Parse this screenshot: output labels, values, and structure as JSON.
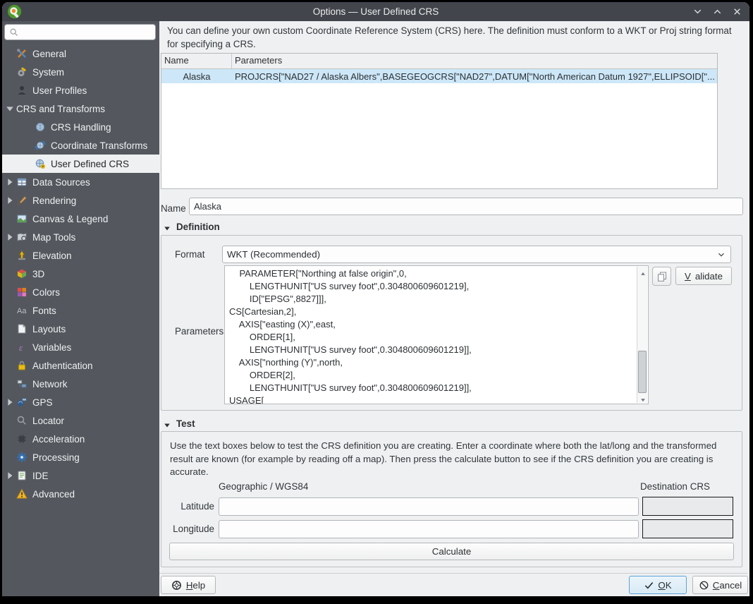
{
  "window": {
    "title": "Options — User Defined CRS",
    "controls": [
      {
        "icon": "chevron-down"
      },
      {
        "icon": "chevron-up"
      },
      {
        "icon": "close"
      }
    ]
  },
  "sidebar": {
    "search_placeholder": "",
    "search_value": "",
    "items": [
      {
        "label": "General",
        "icon": "general",
        "level": 0,
        "expander": null,
        "selected": false
      },
      {
        "label": "System",
        "icon": "system",
        "level": 0,
        "expander": null,
        "selected": false
      },
      {
        "label": "User Profiles",
        "icon": "user-profiles",
        "level": 0,
        "expander": null,
        "selected": false
      },
      {
        "label": "CRS and Transforms",
        "icon": null,
        "level": 0,
        "expander": "expanded",
        "selected": false
      },
      {
        "label": "CRS Handling",
        "icon": "crs-handling",
        "level": 1,
        "expander": null,
        "selected": false
      },
      {
        "label": "Coordinate Transforms",
        "icon": "coordinate-transforms",
        "level": 1,
        "expander": null,
        "selected": false
      },
      {
        "label": "User Defined CRS",
        "icon": "user-defined-crs",
        "level": 1,
        "expander": null,
        "selected": true
      },
      {
        "label": "Data Sources",
        "icon": "data-sources",
        "level": 0,
        "expander": "collapsed",
        "selected": false
      },
      {
        "label": "Rendering",
        "icon": "rendering",
        "level": 0,
        "expander": "collapsed",
        "selected": false
      },
      {
        "label": "Canvas & Legend",
        "icon": "canvas-legend",
        "level": 0,
        "expander": null,
        "selected": false
      },
      {
        "label": "Map Tools",
        "icon": "map-tools",
        "level": 0,
        "expander": "collapsed",
        "selected": false
      },
      {
        "label": "Elevation",
        "icon": "elevation",
        "level": 0,
        "expander": null,
        "selected": false
      },
      {
        "label": "3D",
        "icon": "three-d",
        "level": 0,
        "expander": null,
        "selected": false
      },
      {
        "label": "Colors",
        "icon": "colors",
        "level": 0,
        "expander": null,
        "selected": false
      },
      {
        "label": "Fonts",
        "icon": "fonts",
        "level": 0,
        "expander": null,
        "selected": false
      },
      {
        "label": "Layouts",
        "icon": "layouts",
        "level": 0,
        "expander": null,
        "selected": false
      },
      {
        "label": "Variables",
        "icon": "variables",
        "level": 0,
        "expander": null,
        "selected": false
      },
      {
        "label": "Authentication",
        "icon": "authentication",
        "level": 0,
        "expander": null,
        "selected": false
      },
      {
        "label": "Network",
        "icon": "network",
        "level": 0,
        "expander": null,
        "selected": false
      },
      {
        "label": "GPS",
        "icon": "gps",
        "level": 0,
        "expander": "collapsed",
        "selected": false
      },
      {
        "label": "Locator",
        "icon": "locator",
        "level": 0,
        "expander": null,
        "selected": false
      },
      {
        "label": "Acceleration",
        "icon": "acceleration",
        "level": 0,
        "expander": null,
        "selected": false
      },
      {
        "label": "Processing",
        "icon": "processing",
        "level": 0,
        "expander": null,
        "selected": false
      },
      {
        "label": "IDE",
        "icon": "ide",
        "level": 0,
        "expander": "collapsed",
        "selected": false
      },
      {
        "label": "Advanced",
        "icon": "advanced",
        "level": 0,
        "expander": null,
        "selected": false
      }
    ]
  },
  "main": {
    "intro": "You can define your own custom Coordinate Reference System (CRS) here. The definition must conform to a WKT or Proj string format for specifying a CRS.",
    "crs_table": {
      "columns": [
        "Name",
        "Parameters"
      ],
      "rows": [
        {
          "name": "Alaska",
          "parameters": "PROJCRS[\"NAD27 / Alaska Albers\",BASEGEOGCRS[\"NAD27\",DATUM[\"North American Datum 1927\",ELLIPSOID[\"..."
        }
      ],
      "selected_row": 0
    },
    "name_field": {
      "label": "Name",
      "value": "Alaska"
    },
    "definition": {
      "title": "Definition",
      "format_label": "Format",
      "format_value": "WKT (Recommended)",
      "parameters_label": "Parameters",
      "wkt_text": "    PARAMETER[\"Northing at false origin\",0,\n        LENGTHUNIT[\"US survey foot\",0.304800609601219],\n        ID[\"EPSG\",8827]]],\nCS[Cartesian,2],\n    AXIS[\"easting (X)\",east,\n        ORDER[1],\n        LENGTHUNIT[\"US survey foot\",0.304800609601219]],\n    AXIS[\"northing (Y)\",north,\n        ORDER[2],\n        LENGTHUNIT[\"US survey foot\",0.304800609601219]],\nUSAGE[",
      "validate_label": "Validate"
    },
    "test": {
      "title": "Test",
      "description": "Use the text boxes below to test the CRS definition you are creating. Enter a coordinate where both the lat/long and the transformed result are known (for example by reading off a map). Then press the calculate button to see if the CRS definition you are creating is accurate.",
      "source_label": "Geographic / WGS84",
      "dest_label": "Destination CRS",
      "latitude_label": "Latitude",
      "longitude_label": "Longitude",
      "latitude_value": "",
      "longitude_value": "",
      "latitude_result": "",
      "longitude_result": "",
      "calculate_label": "Calculate"
    },
    "footer": {
      "help": "Help",
      "ok": "OK",
      "cancel": "Cancel"
    }
  },
  "colors": {
    "titlebar": "#42464c",
    "sidebar": "#54585e",
    "selection_blue": "#cde7f8",
    "add_green": "#2e8b3a",
    "remove_red": "#e04343",
    "ok_border": "#5ba3d8"
  }
}
